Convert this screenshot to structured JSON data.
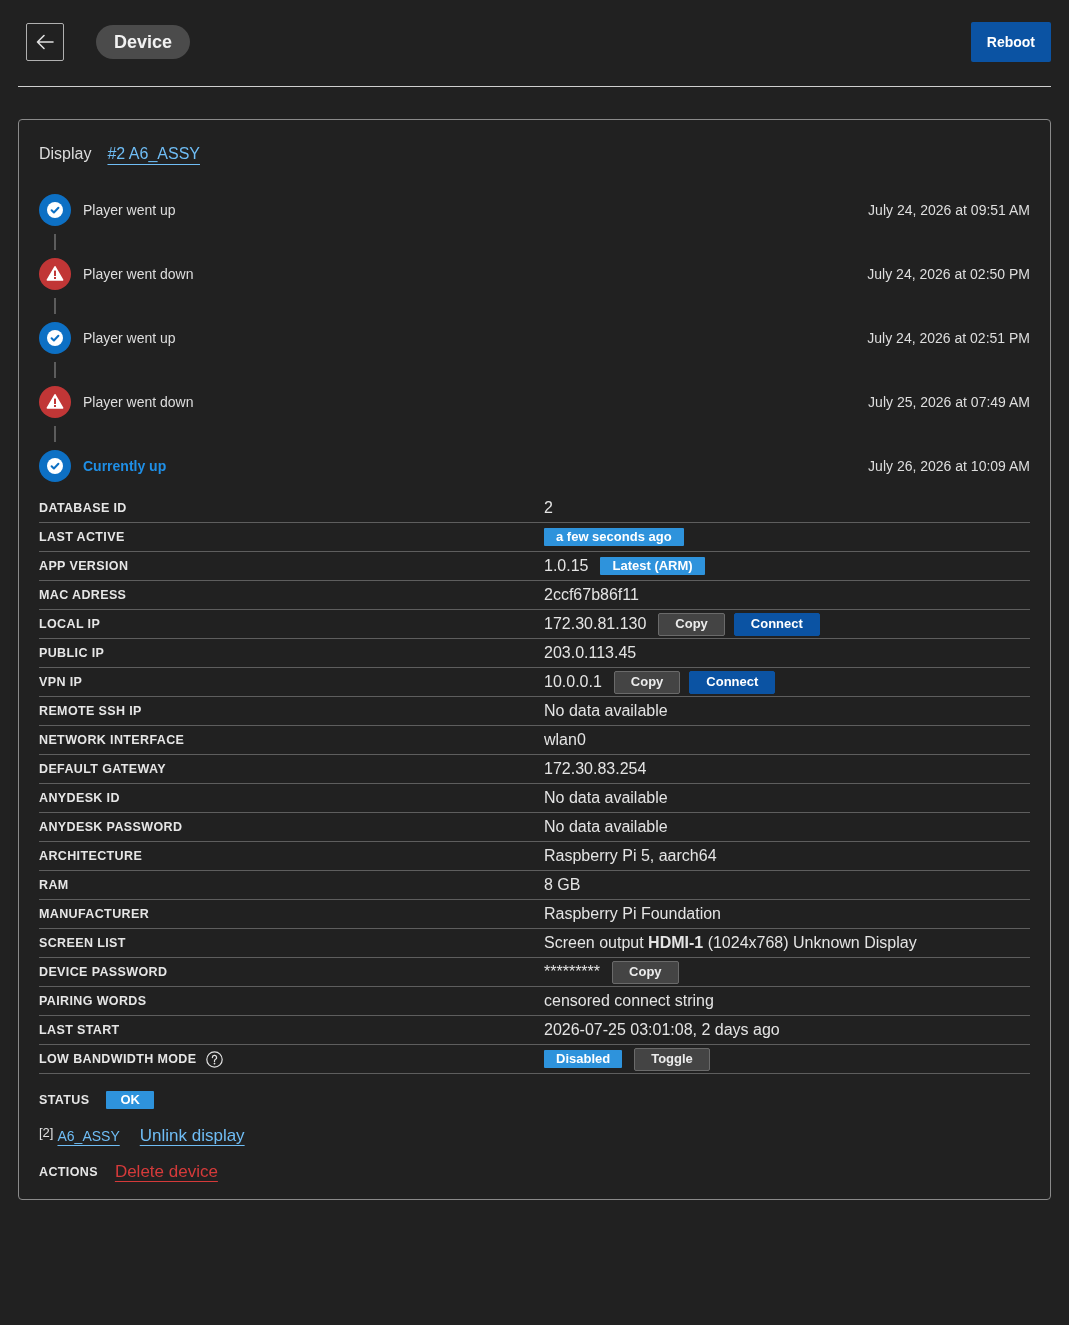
{
  "header": {
    "title": "Device",
    "reboot_button": "Reboot"
  },
  "display": {
    "label": "Display",
    "link": "#2 A6_ASSY"
  },
  "timeline": [
    {
      "kind": "up",
      "text": "Player went up",
      "time": "July 24, 2026 at 09:51 AM",
      "current": false
    },
    {
      "kind": "down",
      "text": "Player went down",
      "time": "July 24, 2026 at 02:50 PM",
      "current": false
    },
    {
      "kind": "up",
      "text": "Player went up",
      "time": "July 24, 2026 at 02:51 PM",
      "current": false
    },
    {
      "kind": "down",
      "text": "Player went down",
      "time": "July 25, 2026 at 07:49 AM",
      "current": false
    },
    {
      "kind": "up",
      "text": "Currently up",
      "time": "July 26, 2026 at 10:09 AM",
      "current": true
    }
  ],
  "details": [
    {
      "label": "DATABASE ID",
      "value": "2"
    },
    {
      "label": "LAST ACTIVE",
      "badge": "a few seconds ago"
    },
    {
      "label": "APP VERSION",
      "value": "1.0.15",
      "badge": "Latest (ARM)"
    },
    {
      "label": "MAC ADRESS",
      "value": "2ccf67b86f11"
    },
    {
      "label": "LOCAL IP",
      "value": "172.30.81.130",
      "buttons": [
        {
          "label": "Copy",
          "kind": "secondary"
        },
        {
          "label": "Connect",
          "kind": "primary"
        }
      ]
    },
    {
      "label": "PUBLIC IP",
      "value": "203.0.113.45"
    },
    {
      "label": "VPN IP",
      "value": "10.0.0.1",
      "buttons": [
        {
          "label": "Copy",
          "kind": "secondary"
        },
        {
          "label": "Connect",
          "kind": "primary"
        }
      ]
    },
    {
      "label": "REMOTE SSH IP",
      "value": "No data available"
    },
    {
      "label": "NETWORK INTERFACE",
      "value": "wlan0"
    },
    {
      "label": "DEFAULT GATEWAY",
      "value": "172.30.83.254"
    },
    {
      "label": "ANYDESK ID",
      "value": "No data available"
    },
    {
      "label": "ANYDESK PASSWORD",
      "value": "No data available"
    },
    {
      "label": "ARCHITECTURE",
      "value": "Raspberry Pi 5, aarch64"
    },
    {
      "label": "RAM",
      "value": "8 GB"
    },
    {
      "label": "MANUFACTURER",
      "value": "Raspberry Pi Foundation"
    },
    {
      "label": "SCREEN LIST",
      "rich_value": "Screen output **HDMI-1** (1024x768) Unknown Display"
    },
    {
      "label": "DEVICE PASSWORD",
      "value": "*********",
      "buttons": [
        {
          "label": "Copy",
          "kind": "secondary"
        }
      ]
    },
    {
      "label": "PAIRING WORDS",
      "value": "censored connect string"
    },
    {
      "label": "LAST START",
      "value": "2026-07-25 03:01:08, 2 days ago"
    },
    {
      "label": "LOW BANDWIDTH MODE",
      "help": true,
      "badge": "Disabled",
      "buttons": [
        {
          "label": "Toggle",
          "kind": "secondary"
        }
      ]
    }
  ],
  "status": {
    "label": "STATUS",
    "badge": "OK"
  },
  "linked_display": {
    "index": "[2]",
    "name": "A6_ASSY",
    "unlink": "Unlink display"
  },
  "actions": {
    "label": "ACTIONS",
    "delete": "Delete device"
  }
}
